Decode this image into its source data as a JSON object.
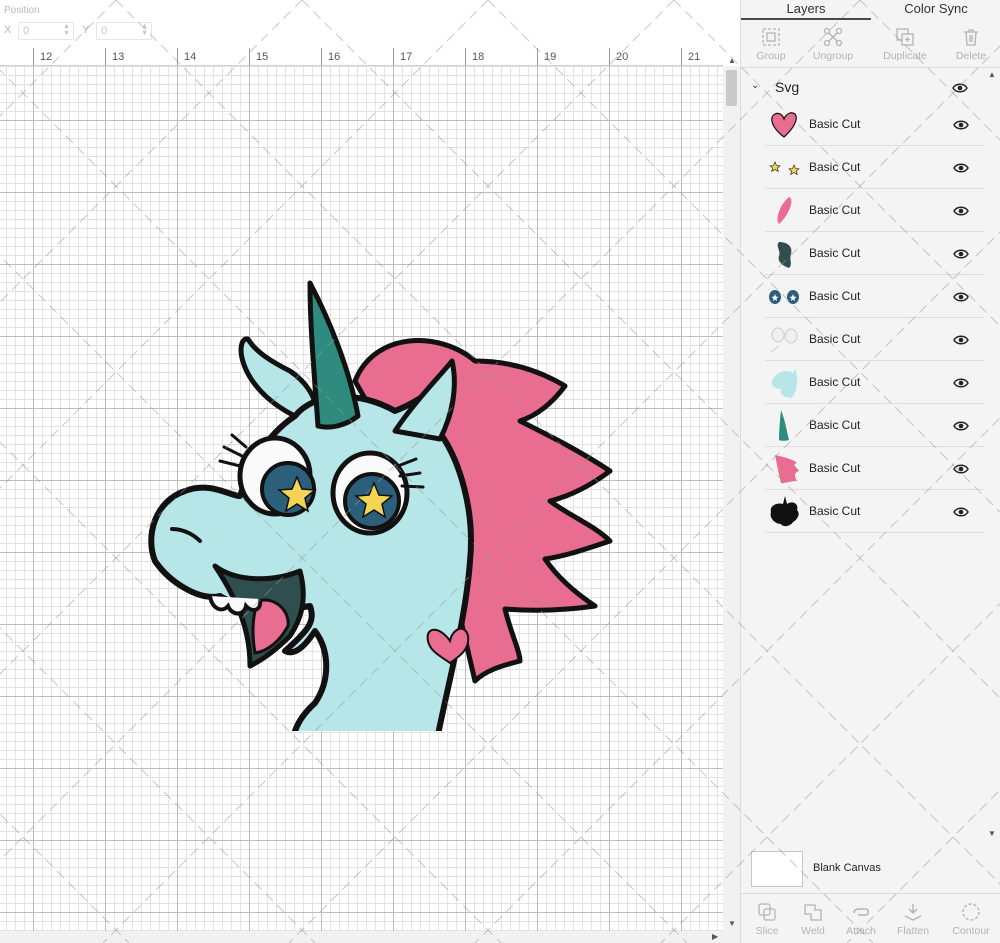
{
  "position": {
    "label": "Position",
    "x_label": "X",
    "y_label": "Y",
    "x_value": "0",
    "y_value": "0"
  },
  "ruler": {
    "ticks": [
      "12",
      "13",
      "14",
      "15",
      "16",
      "17",
      "18",
      "19",
      "20",
      "21"
    ]
  },
  "panel": {
    "tabs": [
      {
        "label": "Layers",
        "active": true
      },
      {
        "label": "Color Sync",
        "active": false
      }
    ],
    "tools": [
      {
        "label": "Group",
        "icon": "group-icon"
      },
      {
        "label": "Ungroup",
        "icon": "ungroup-icon"
      },
      {
        "label": "Duplicate",
        "icon": "duplicate-icon"
      },
      {
        "label": "Delete",
        "icon": "trash-icon"
      }
    ],
    "group_name": "Svg",
    "layers": [
      {
        "label": "Basic Cut",
        "thumb": "heart",
        "color": "#e96c91"
      },
      {
        "label": "Basic Cut",
        "thumb": "stars",
        "color": "#f3d454"
      },
      {
        "label": "Basic Cut",
        "thumb": "tongue",
        "color": "#e96c91"
      },
      {
        "label": "Basic Cut",
        "thumb": "mouth",
        "color": "#2f4f4f"
      },
      {
        "label": "Basic Cut",
        "thumb": "eyes",
        "color": "#2c5f7c"
      },
      {
        "label": "Basic Cut",
        "thumb": "eye-whites",
        "color": "#f0f0f0"
      },
      {
        "label": "Basic Cut",
        "thumb": "head",
        "color": "#b7e6e8"
      },
      {
        "label": "Basic Cut",
        "thumb": "horn",
        "color": "#2e8b7d"
      },
      {
        "label": "Basic Cut",
        "thumb": "mane",
        "color": "#e96c91"
      },
      {
        "label": "Basic Cut",
        "thumb": "outline",
        "color": "#111111"
      }
    ],
    "blank_canvas_label": "Blank Canvas",
    "bottom_tools": [
      {
        "label": "Slice",
        "icon": "slice-icon"
      },
      {
        "label": "Weld",
        "icon": "weld-icon"
      },
      {
        "label": "Attach",
        "icon": "attach-icon"
      },
      {
        "label": "Flatten",
        "icon": "flatten-icon"
      },
      {
        "label": "Contour",
        "icon": "contour-icon"
      }
    ]
  },
  "colors": {
    "head": "#b7e6e8",
    "mane": "#e96c91",
    "horn": "#2e8b7d",
    "iris": "#2c5f7c",
    "star": "#f3d454",
    "outline": "#111111"
  }
}
